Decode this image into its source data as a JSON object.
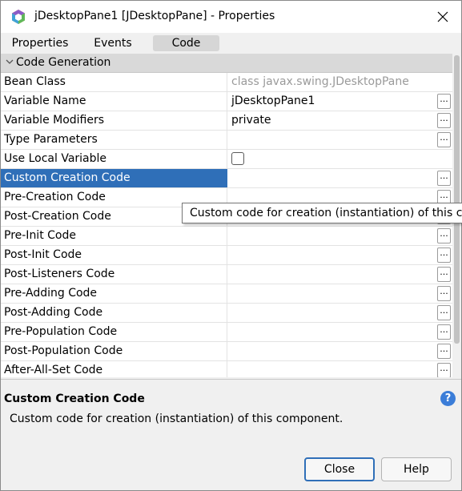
{
  "window": {
    "title": "jDesktopPane1 [JDesktopPane] - Properties"
  },
  "tabs": [
    {
      "label": "Properties"
    },
    {
      "label": "Events"
    },
    {
      "label": "Code",
      "active": true
    }
  ],
  "category": {
    "label": "Code Generation"
  },
  "properties": [
    {
      "name": "Bean Class",
      "value": "class javax.swing.JDesktopPane"
    },
    {
      "name": "Variable Name",
      "value": "jDesktopPane1"
    },
    {
      "name": "Variable Modifiers",
      "value": "private"
    },
    {
      "name": "Type Parameters",
      "value": ""
    },
    {
      "name": "Use Local Variable",
      "value": "",
      "checked": false
    },
    {
      "name": "Custom Creation Code",
      "value": "",
      "selected": true
    },
    {
      "name": "Pre-Creation Code",
      "value": ""
    },
    {
      "name": "Post-Creation Code",
      "value": ""
    },
    {
      "name": "Pre-Init Code",
      "value": ""
    },
    {
      "name": "Post-Init Code",
      "value": ""
    },
    {
      "name": "Post-Listeners Code",
      "value": ""
    },
    {
      "name": "Pre-Adding Code",
      "value": ""
    },
    {
      "name": "Post-Adding Code",
      "value": ""
    },
    {
      "name": "Pre-Population Code",
      "value": ""
    },
    {
      "name": "Post-Population Code",
      "value": ""
    },
    {
      "name": "After-All-Set Code",
      "value": ""
    }
  ],
  "ellipsis_label": "...",
  "tooltip": {
    "text": "Custom code for creation (instantiation) of this com"
  },
  "description": {
    "title": "Custom Creation Code",
    "text": "Custom code for creation (instantiation) of this component.",
    "help_glyph": "?"
  },
  "buttons": {
    "close": "Close",
    "help": "Help"
  },
  "colors": {
    "selection": "#2f6fb8",
    "category_bg": "#d9d9d9",
    "help_icon": "#3b7dd8"
  },
  "icons": {
    "app": "netbeans-logo-icon",
    "close": "close-icon",
    "collapse": "chevron-down-icon",
    "help": "help-icon"
  }
}
